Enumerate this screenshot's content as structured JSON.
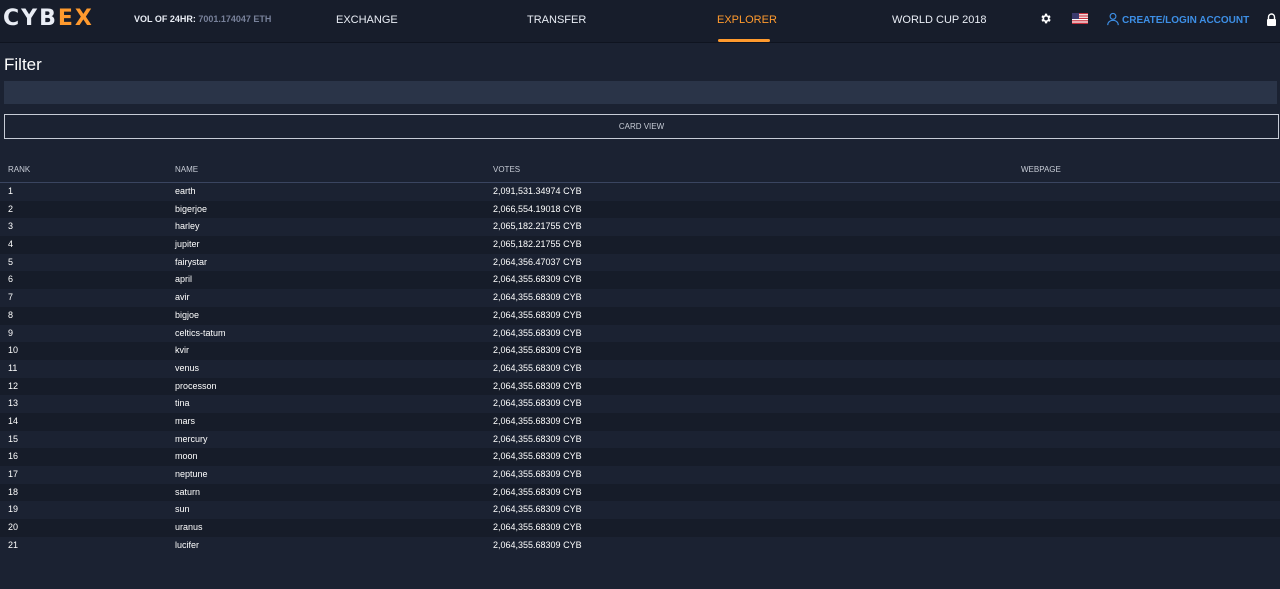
{
  "header": {
    "logo_left": "CYB",
    "logo_right": "EX",
    "vol_label": "VOL OF 24HR:",
    "vol_value": "7001.174047 ETH",
    "nav": [
      "EXCHANGE",
      "TRANSFER",
      "EXPLORER",
      "WORLD CUP 2018"
    ],
    "active_nav": "EXPLORER",
    "account_label": "CREATE/LOGIN ACCOUNT",
    "accent_color": "#ff9a2e",
    "link_color": "#3d8fe6"
  },
  "filter": {
    "title": "Filter",
    "value": "",
    "card_view_label": "CARD VIEW"
  },
  "table": {
    "columns": [
      "RANK",
      "NAME",
      "VOTES",
      "WEBPAGE"
    ],
    "rows": [
      {
        "rank": "1",
        "name": "earth",
        "votes": "2,091,531.34974 CYB",
        "webpage": ""
      },
      {
        "rank": "2",
        "name": "bigerjoe",
        "votes": "2,066,554.19018 CYB",
        "webpage": ""
      },
      {
        "rank": "3",
        "name": "harley",
        "votes": "2,065,182.21755 CYB",
        "webpage": ""
      },
      {
        "rank": "4",
        "name": "jupiter",
        "votes": "2,065,182.21755 CYB",
        "webpage": ""
      },
      {
        "rank": "5",
        "name": "fairystar",
        "votes": "2,064,356.47037 CYB",
        "webpage": ""
      },
      {
        "rank": "6",
        "name": "april",
        "votes": "2,064,355.68309 CYB",
        "webpage": ""
      },
      {
        "rank": "7",
        "name": "avir",
        "votes": "2,064,355.68309 CYB",
        "webpage": ""
      },
      {
        "rank": "8",
        "name": "bigjoe",
        "votes": "2,064,355.68309 CYB",
        "webpage": ""
      },
      {
        "rank": "9",
        "name": "celtics-tatum",
        "votes": "2,064,355.68309 CYB",
        "webpage": ""
      },
      {
        "rank": "10",
        "name": "kvir",
        "votes": "2,064,355.68309 CYB",
        "webpage": ""
      },
      {
        "rank": "11",
        "name": "venus",
        "votes": "2,064,355.68309 CYB",
        "webpage": ""
      },
      {
        "rank": "12",
        "name": "processon",
        "votes": "2,064,355.68309 CYB",
        "webpage": ""
      },
      {
        "rank": "13",
        "name": "tina",
        "votes": "2,064,355.68309 CYB",
        "webpage": ""
      },
      {
        "rank": "14",
        "name": "mars",
        "votes": "2,064,355.68309 CYB",
        "webpage": ""
      },
      {
        "rank": "15",
        "name": "mercury",
        "votes": "2,064,355.68309 CYB",
        "webpage": ""
      },
      {
        "rank": "16",
        "name": "moon",
        "votes": "2,064,355.68309 CYB",
        "webpage": ""
      },
      {
        "rank": "17",
        "name": "neptune",
        "votes": "2,064,355.68309 CYB",
        "webpage": ""
      },
      {
        "rank": "18",
        "name": "saturn",
        "votes": "2,064,355.68309 CYB",
        "webpage": ""
      },
      {
        "rank": "19",
        "name": "sun",
        "votes": "2,064,355.68309 CYB",
        "webpage": ""
      },
      {
        "rank": "20",
        "name": "uranus",
        "votes": "2,064,355.68309 CYB",
        "webpage": ""
      },
      {
        "rank": "21",
        "name": "lucifer",
        "votes": "2,064,355.68309 CYB",
        "webpage": ""
      }
    ]
  }
}
